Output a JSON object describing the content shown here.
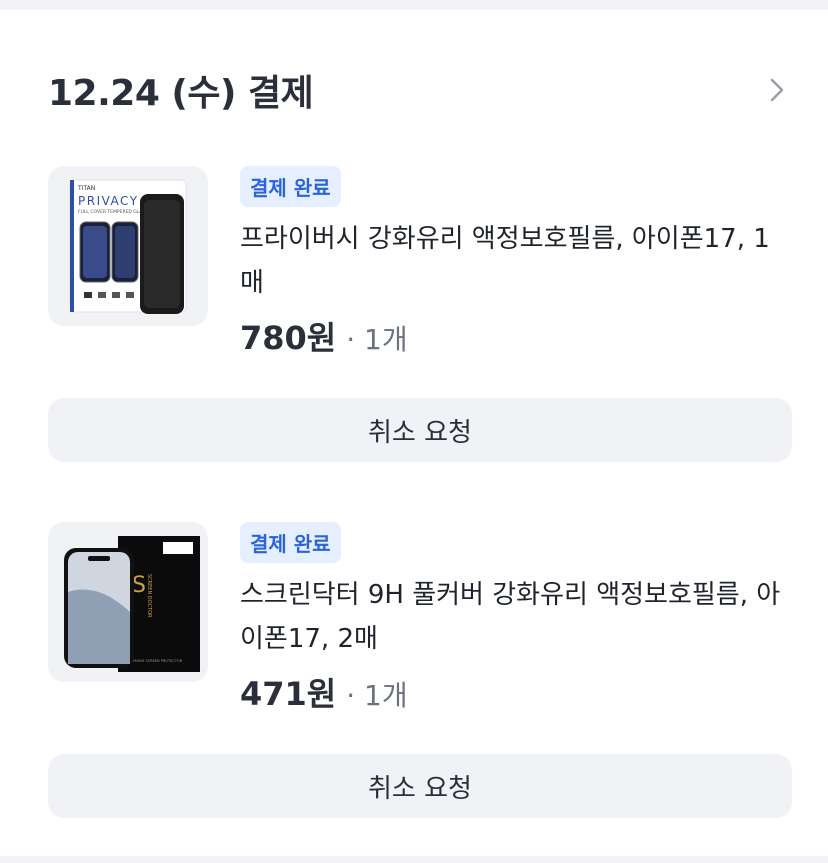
{
  "order": {
    "date_header": "12.24 (수) 결제",
    "chevron_icon": "chevron-right-icon"
  },
  "items": [
    {
      "status": "결제 완료",
      "title": "프라이버시 강화유리 액정보호필름, 아이폰17, 1매",
      "price": "780원",
      "qty": "· 1개",
      "thumb_text": {
        "brand": "TITAN",
        "product": "PRIVACY",
        "sub": "FULL COVER TEMPERED GLASS"
      },
      "cancel_label": "취소 요청"
    },
    {
      "status": "결제 완료",
      "title": "스크린닥터 9H 풀커버 강화유리 액정보호필름, 아이폰17, 2매",
      "price": "471원",
      "qty": "· 1개",
      "thumb_text": {
        "brand": "SCREEN DOCTOR",
        "sub": "PREMIUM SCREEN PROTECTOR"
      },
      "cancel_label": "취소 요청"
    }
  ],
  "colors": {
    "badge_bg": "#e6efff",
    "badge_text": "#2b63d9",
    "button_bg": "#f1f2f5",
    "text_primary": "#2a2f3a"
  }
}
